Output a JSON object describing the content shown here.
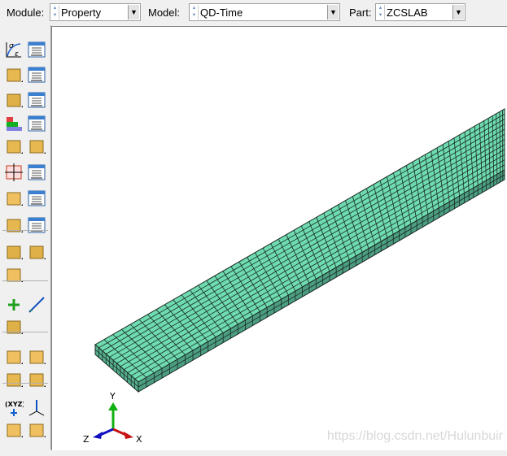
{
  "topbar": {
    "module": {
      "label": "Module:",
      "value": "Property"
    },
    "model": {
      "label": "Model:",
      "value": "QD-Time"
    },
    "part": {
      "label": "Part:",
      "value": "ZCSLAB"
    }
  },
  "toolbox": {
    "icons": [
      "material-create-icon",
      "material-manager-icon",
      "section-create-icon",
      "section-manager-icon",
      "profile-create-icon",
      "profile-manager-icon",
      "composite-layup-icon",
      "composite-manager-icon",
      "section-assign-icon",
      "beam-orientation-icon",
      "orientation-assign-icon",
      "orientation-manager-icon",
      "skin-create-icon",
      "skin-manager-icon",
      "stringer-icon",
      "stringer-manager-icon",
      "special-inertia-icon",
      "springs-dashpots-icon",
      "delete-inertia-icon",
      "datum-point-icon",
      "datum-axis-icon",
      "partition-cell-icon",
      "attachment-points-icon",
      "set-icon",
      "partition-icon",
      "cut-icon",
      "query-csys-icon",
      "view-triad-icon",
      "datum-csys-icon",
      "datum-plane-icon"
    ]
  },
  "viewport": {
    "triad": {
      "x": "X",
      "y": "Y",
      "z": "Z"
    },
    "watermark": "https://blog.csdn.net/Hulunbuir",
    "colors": {
      "mesh_top": "#6edbb0",
      "mesh_side": "#4c9e82",
      "mesh_end": "#56b090",
      "x_axis": "#d01010",
      "y_axis": "#10b010",
      "z_axis": "#1010c0"
    }
  }
}
